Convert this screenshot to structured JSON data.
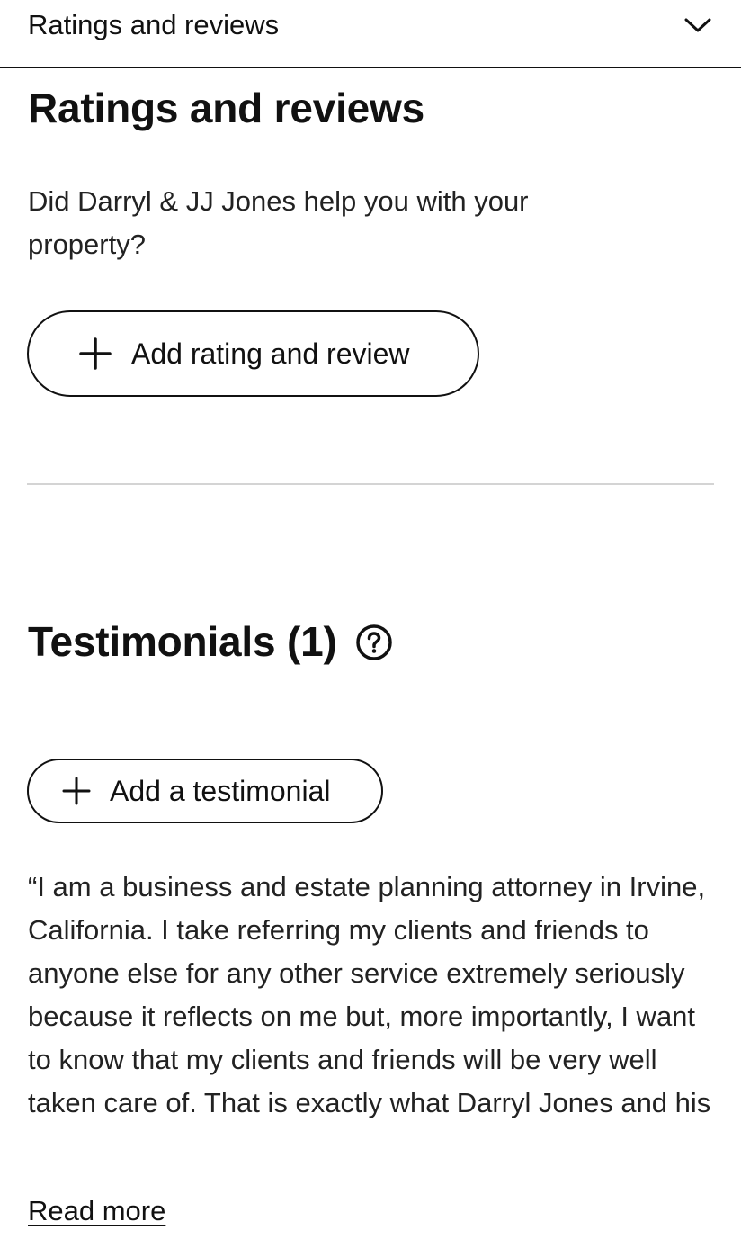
{
  "section_bar": {
    "title": "Ratings and reviews",
    "toggle_icon": "chevron-down-icon"
  },
  "ratings": {
    "heading": "Ratings and reviews",
    "question": "Did Darryl & JJ Jones help you with your property?",
    "add_button_label": "Add rating and review",
    "add_button_icon": "plus-icon"
  },
  "testimonials": {
    "heading": "Testimonials (1)",
    "help_icon": "question-circle-icon",
    "add_button_label": "Add a testimonial",
    "add_button_icon": "plus-icon",
    "items": [
      {
        "text": "“I am a business and estate planning attorney in Irvine, California. I take referring my clients and friends to anyone else for any other service extremely seriously because it reflects on me but, more importantly, I want to know that my clients and friends will be very well taken care of. That is exactly what Darryl Jones and his",
        "read_more_label": "Read more"
      }
    ]
  },
  "colors": {
    "text": "#111111",
    "divider": "#d4d4d4",
    "background": "#ffffff"
  }
}
